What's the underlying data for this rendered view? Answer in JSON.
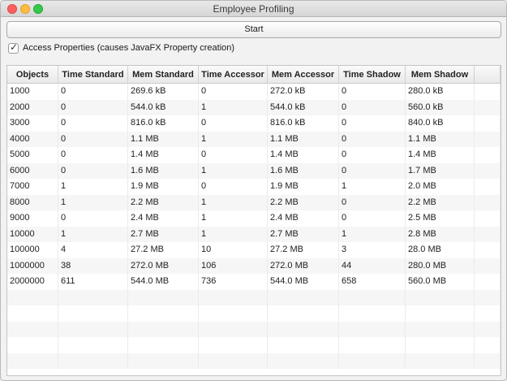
{
  "window": {
    "title": "Employee Profiling"
  },
  "start_button": {
    "label": "Start"
  },
  "access_checkbox": {
    "checked": true,
    "label": "Access Properties (causes JavaFX Property creation)"
  },
  "table": {
    "columns": [
      "Objects",
      "Time Standard",
      "Mem Standard",
      "Time Accessor",
      "Mem Accessor",
      "Time Shadow",
      "Mem Shadow"
    ],
    "rows": [
      [
        "1000",
        "0",
        "269.6 kB",
        "0",
        "272.0 kB",
        "0",
        "280.0 kB"
      ],
      [
        "2000",
        "0",
        "544.0 kB",
        "1",
        "544.0 kB",
        "0",
        "560.0 kB"
      ],
      [
        "3000",
        "0",
        "816.0 kB",
        "0",
        "816.0 kB",
        "0",
        "840.0 kB"
      ],
      [
        "4000",
        "0",
        "1.1 MB",
        "1",
        "1.1 MB",
        "0",
        "1.1 MB"
      ],
      [
        "5000",
        "0",
        "1.4 MB",
        "0",
        "1.4 MB",
        "0",
        "1.4 MB"
      ],
      [
        "6000",
        "0",
        "1.6 MB",
        "1",
        "1.6 MB",
        "0",
        "1.7 MB"
      ],
      [
        "7000",
        "1",
        "1.9 MB",
        "0",
        "1.9 MB",
        "1",
        "2.0 MB"
      ],
      [
        "8000",
        "1",
        "2.2 MB",
        "1",
        "2.2 MB",
        "0",
        "2.2 MB"
      ],
      [
        "9000",
        "0",
        "2.4 MB",
        "1",
        "2.4 MB",
        "0",
        "2.5 MB"
      ],
      [
        "10000",
        "1",
        "2.7 MB",
        "1",
        "2.7 MB",
        "1",
        "2.8 MB"
      ],
      [
        "100000",
        "4",
        "27.2 MB",
        "10",
        "27.2 MB",
        "3",
        "28.0 MB"
      ],
      [
        "1000000",
        "38",
        "272.0 MB",
        "106",
        "272.0 MB",
        "44",
        "280.0 MB"
      ],
      [
        "2000000",
        "611",
        "544.0 MB",
        "736",
        "544.0 MB",
        "658",
        "560.0 MB"
      ]
    ]
  }
}
